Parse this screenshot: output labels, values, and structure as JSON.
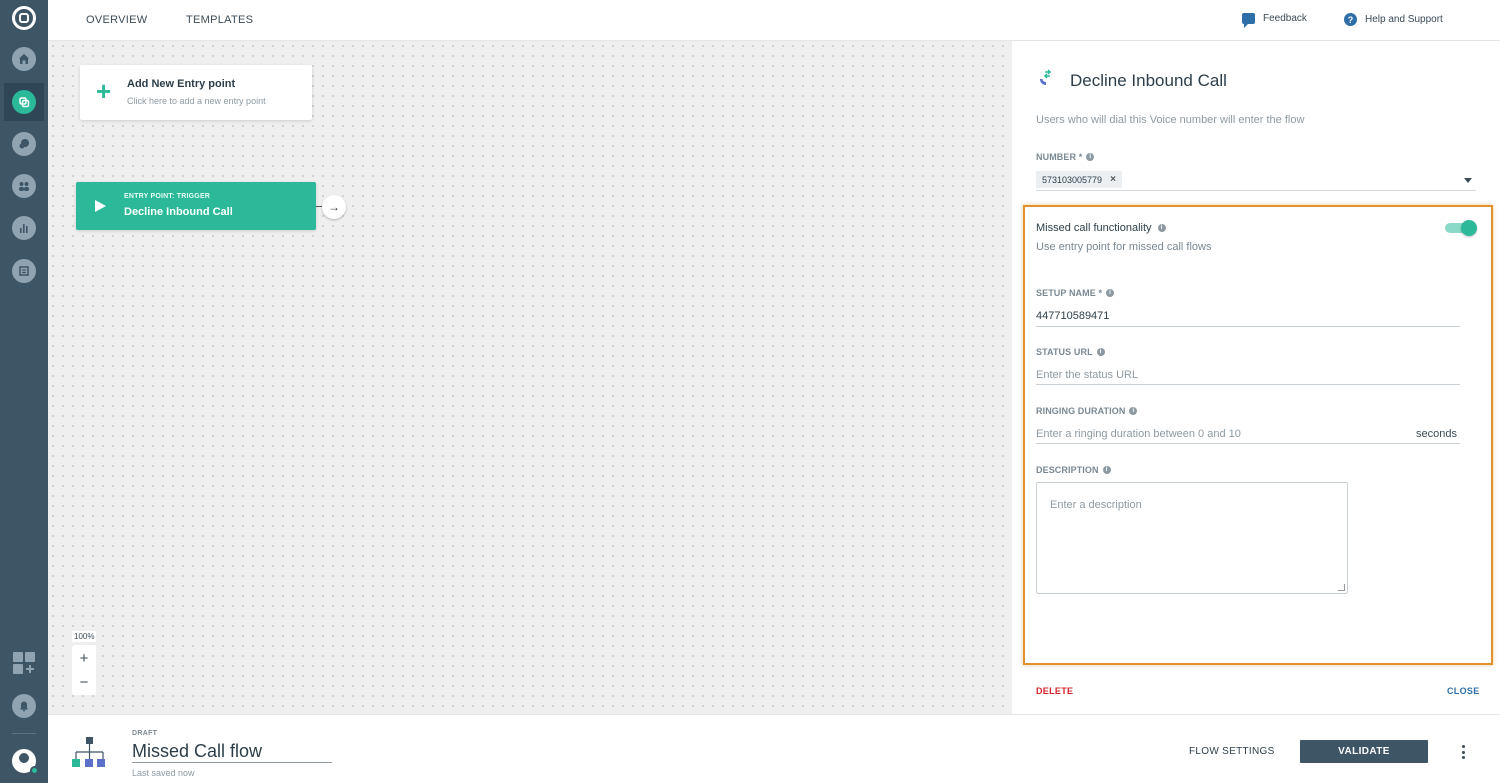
{
  "topbar": {
    "tabs": [
      "OVERVIEW",
      "TEMPLATES"
    ],
    "feedback": "Feedback",
    "help": "Help and Support"
  },
  "canvas": {
    "add_entry": {
      "title": "Add New Entry point",
      "subtitle": "Click here to add a new entry point"
    },
    "entry": {
      "label": "ENTRY POINT: TRIGGER",
      "title": "Decline Inbound Call"
    },
    "zoom": "100%",
    "zoom_in": "+",
    "zoom_out": "−"
  },
  "panel": {
    "title": "Decline Inbound Call",
    "description": "Users who will dial this Voice number will enter the flow",
    "number_label": "NUMBER *",
    "number_chip": "573103005779",
    "chip_remove": "×",
    "missed_call": {
      "title": "Missed call functionality",
      "subtitle": "Use entry point for missed call flows",
      "enabled": true
    },
    "setup_name": {
      "label": "SETUP NAME *",
      "value": "447710589471"
    },
    "status_url": {
      "label": "STATUS URL",
      "placeholder": "Enter the status URL"
    },
    "ringing": {
      "label": "RINGING DURATION",
      "placeholder": "Enter a ringing duration between 0 and 10",
      "unit": "seconds"
    },
    "description_field": {
      "label": "DESCRIPTION",
      "placeholder": "Enter a description"
    },
    "delete": "DELETE",
    "close": "CLOSE"
  },
  "bottombar": {
    "status": "DRAFT",
    "flow_name": "Missed Call flow",
    "saved": "Last saved now",
    "flow_settings": "FLOW SETTINGS",
    "validate": "VALIDATE"
  },
  "colors": {
    "accent": "#2bb99a",
    "sidebar": "#3e5566",
    "highlight": "#e0922d",
    "danger": "#d0262e",
    "link": "#2f6fa7"
  }
}
